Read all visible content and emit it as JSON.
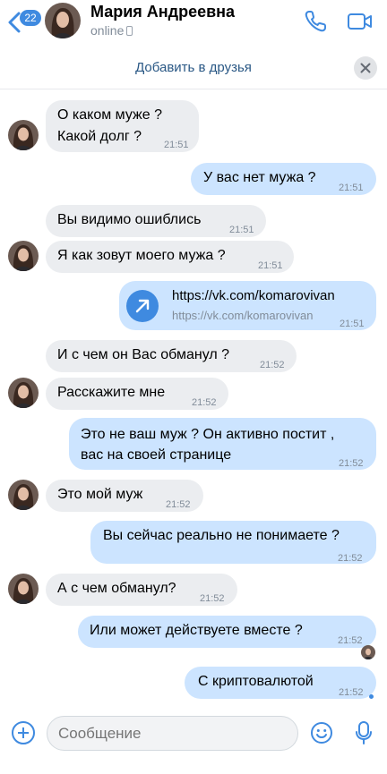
{
  "header": {
    "back_badge": "22",
    "contact_name": "Мария Андреевна",
    "status": "online"
  },
  "friend_bar": {
    "label": "Добавить в друзья"
  },
  "messages": [
    {
      "dir": "in",
      "lines": [
        "О каком муже ?",
        "Какой долг ?"
      ],
      "time": "21:51"
    },
    {
      "dir": "out",
      "lines": [
        "У вас нет мужа ?"
      ],
      "time": "21:51"
    },
    {
      "dir": "in",
      "lines": [
        "Вы видимо ошиблись"
      ],
      "time": "21:51"
    },
    {
      "dir": "in",
      "lines": [
        "Я как зовут моего мужа ?"
      ],
      "time": "21:51"
    },
    {
      "dir": "out",
      "link_title": "https://vk.com/komarovivan",
      "link_url": "https://vk.com/komarovivan",
      "time": "21:51"
    },
    {
      "dir": "in",
      "lines": [
        "И с чем он Вас обманул ?"
      ],
      "time": "21:52"
    },
    {
      "dir": "in",
      "lines": [
        "Расскажите мне"
      ],
      "time": "21:52"
    },
    {
      "dir": "out",
      "lines": [
        "Это не ваш муж ? Он активно постит ,",
        "вас на своей странице"
      ],
      "time": "21:52"
    },
    {
      "dir": "in",
      "lines": [
        "Это мой муж"
      ],
      "time": "21:52"
    },
    {
      "dir": "out",
      "lines": [
        "Вы сейчас реально не понимаете ?"
      ],
      "time": "21:52"
    },
    {
      "dir": "in",
      "lines": [
        "А с чем обманул?"
      ],
      "time": "21:52"
    },
    {
      "dir": "out",
      "lines": [
        "Или может действуете вместе ?"
      ],
      "time": "21:52"
    },
    {
      "dir": "out",
      "lines": [
        "С криптовалютой"
      ],
      "time": "21:52"
    }
  ],
  "composer": {
    "placeholder": "Сообщение"
  },
  "colors": {
    "accent": "#3f8ae0",
    "incoming_bubble": "#ebedf0",
    "outgoing_bubble": "#cce4ff",
    "link": "#2a5885"
  },
  "icons": {
    "back": "chevron-left-icon",
    "call": "phone-icon",
    "video": "video-camera-icon",
    "close": "close-icon",
    "attach": "plus-circle-icon",
    "emoji": "smile-icon",
    "mic": "microphone-icon",
    "link": "arrow-up-right-icon"
  }
}
